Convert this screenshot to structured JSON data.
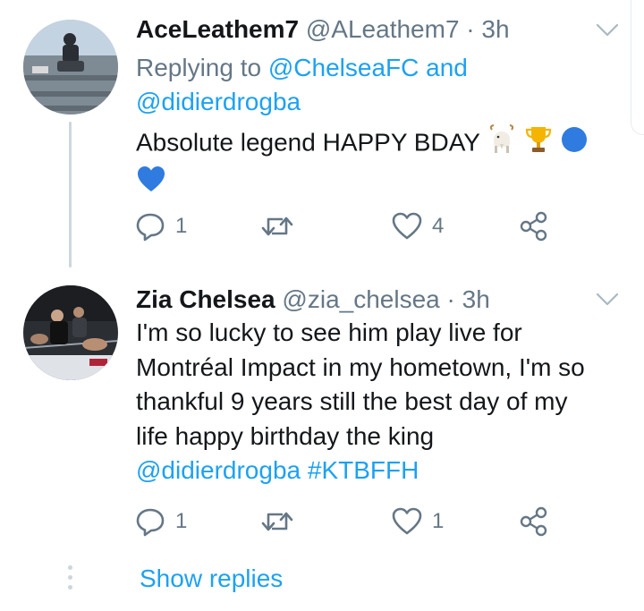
{
  "tweets": [
    {
      "name": "AceLeathem7",
      "handle": "@ALeathem7",
      "separator": "·",
      "time": "3h",
      "replying_prefix": "Replying to",
      "replying_mention_1": "@ChelseaFC",
      "replying_and": "and",
      "replying_mention_2": "@didierdrogba",
      "text": "Absolute legend HAPPY BDAY",
      "emojis": [
        "goat-icon",
        "trophy-icon",
        "blue-circle-icon",
        "blue-heart-icon"
      ],
      "reply_count": "1",
      "retweet_count": "",
      "like_count": "4"
    },
    {
      "name": "Zia Chelsea",
      "handle": "@zia_chelsea",
      "separator": "·",
      "time": "3h",
      "text_lines": [
        "I'm so lucky to see him play live for",
        "Montréal Impact in my hometown, I'm so",
        "thankful 9 years still the best day of my",
        "life happy birthday the king"
      ],
      "mention": "@didierdrogba",
      "hashtag": "#KTBFFH",
      "reply_count": "1",
      "retweet_count": "",
      "like_count": "1"
    }
  ],
  "show_replies": "Show replies",
  "colors": {
    "link": "#1da1f2",
    "secondary": "#657786",
    "text": "#14171a",
    "thread_line": "#ccd6dd"
  }
}
